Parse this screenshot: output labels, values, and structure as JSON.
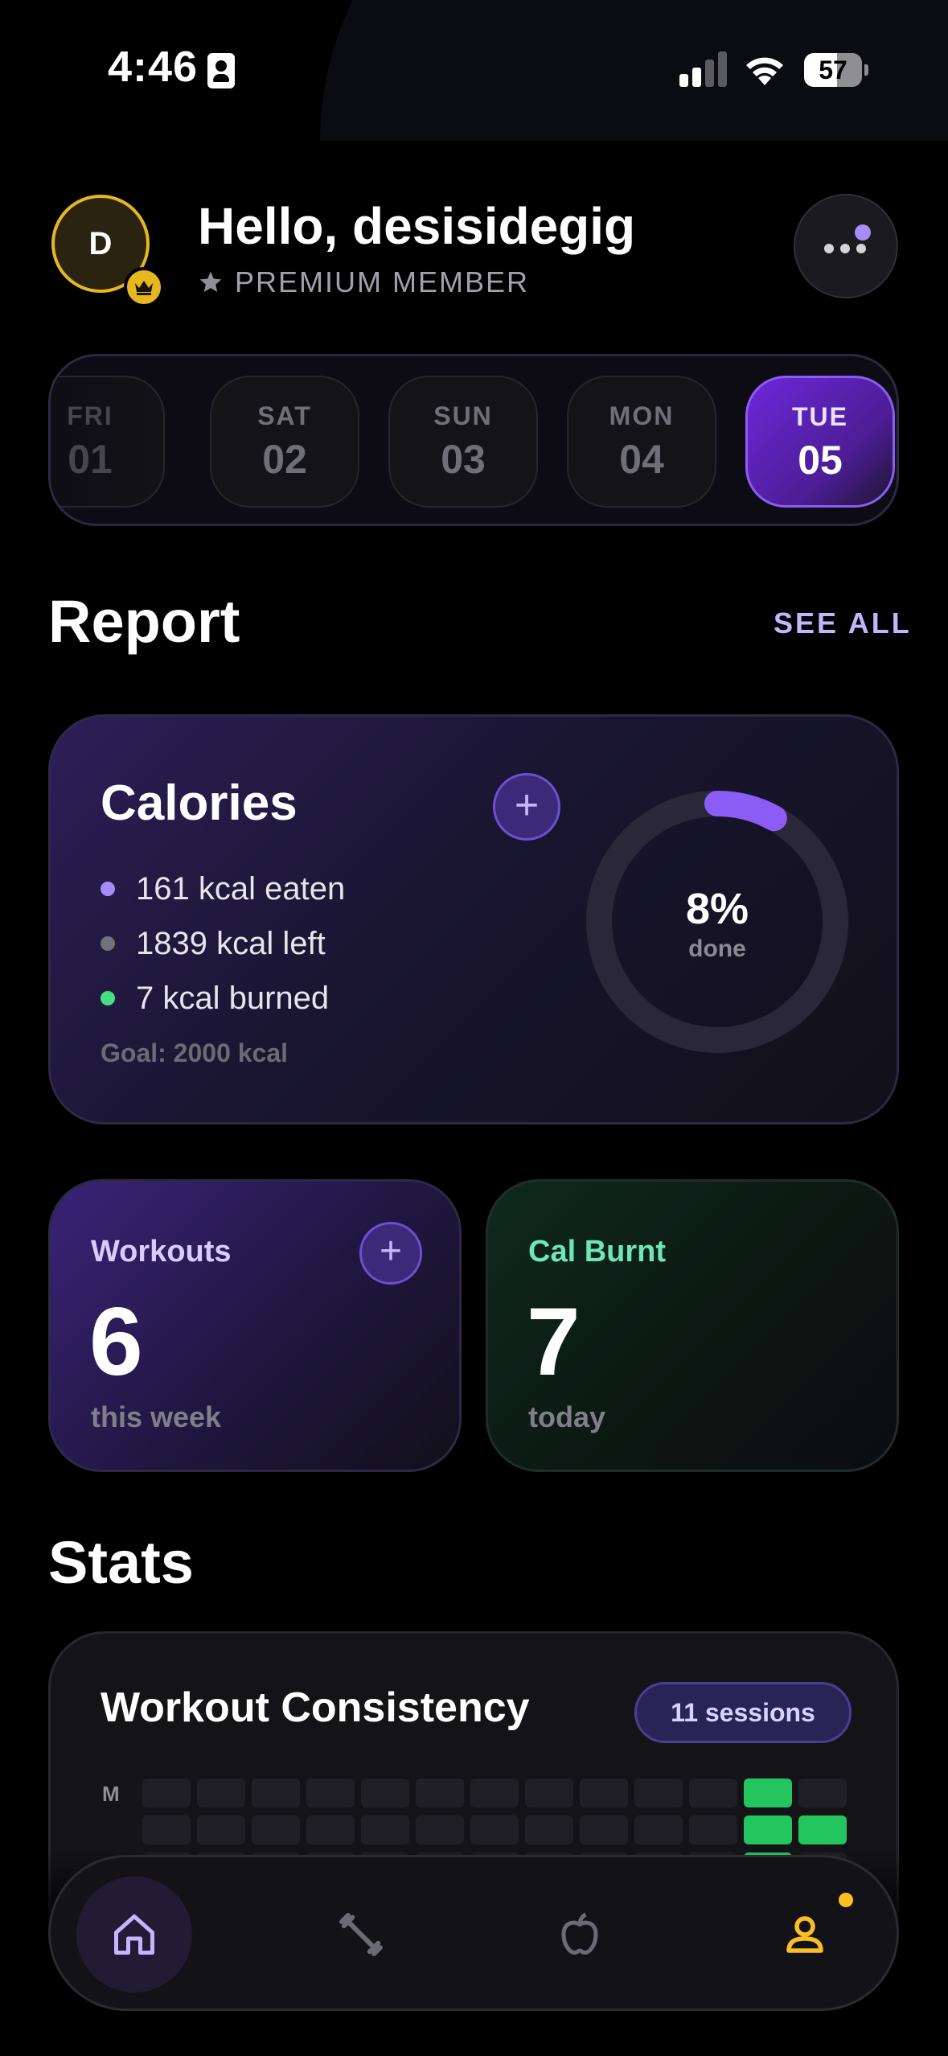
{
  "status_bar": {
    "time": "4:46",
    "battery": "57",
    "battery_level": 0.57
  },
  "header": {
    "avatar_initial": "D",
    "greeting": "Hello, desisidegig",
    "member_label": "PREMIUM MEMBER"
  },
  "dates": [
    {
      "day": "FRI",
      "num": "01",
      "state": "faded"
    },
    {
      "day": "SAT",
      "num": "02",
      "state": "normal"
    },
    {
      "day": "SUN",
      "num": "03",
      "state": "normal"
    },
    {
      "day": "MON",
      "num": "04",
      "state": "normal"
    },
    {
      "day": "TUE",
      "num": "05",
      "state": "active"
    }
  ],
  "report": {
    "title": "Report",
    "see_all": "SEE ALL"
  },
  "calories": {
    "title": "Calories",
    "add_label": "+",
    "legend": [
      {
        "text": "161 kcal eaten",
        "color": "#a78bfa"
      },
      {
        "text": "1839 kcal left",
        "color": "#71717a"
      },
      {
        "text": "7 kcal burned",
        "color": "#4ade80"
      }
    ],
    "goal": "Goal: 2000 kcal",
    "percent_label": "8%",
    "done_label": "done",
    "progress": 0.08,
    "ring_color": "#8b5cf6",
    "track_color": "#2a2838"
  },
  "workouts": {
    "label": "Workouts",
    "value": "6",
    "sub": "this week",
    "add_label": "+"
  },
  "cal_burnt": {
    "label": "Cal Burnt",
    "value": "7",
    "sub": "today"
  },
  "stats": {
    "title": "Stats"
  },
  "consistency": {
    "title": "Workout Consistency",
    "sessions": "11 sessions",
    "row_labels": [
      "M",
      "",
      ""
    ],
    "rows": [
      [
        0,
        0,
        0,
        0,
        0,
        0,
        0,
        0,
        0,
        0,
        0,
        1,
        0
      ],
      [
        0,
        0,
        0,
        0,
        0,
        0,
        0,
        0,
        0,
        0,
        0,
        1,
        1
      ],
      [
        0,
        0,
        0,
        0,
        0,
        0,
        0,
        0,
        0,
        0,
        0,
        1,
        0
      ]
    ]
  },
  "nav": {
    "items": [
      "home-icon",
      "dumbbell-icon",
      "apple-icon",
      "profile-icon"
    ],
    "active": "home-icon",
    "active_color": "#c4b5fd",
    "profile_color": "#fbbf24"
  }
}
